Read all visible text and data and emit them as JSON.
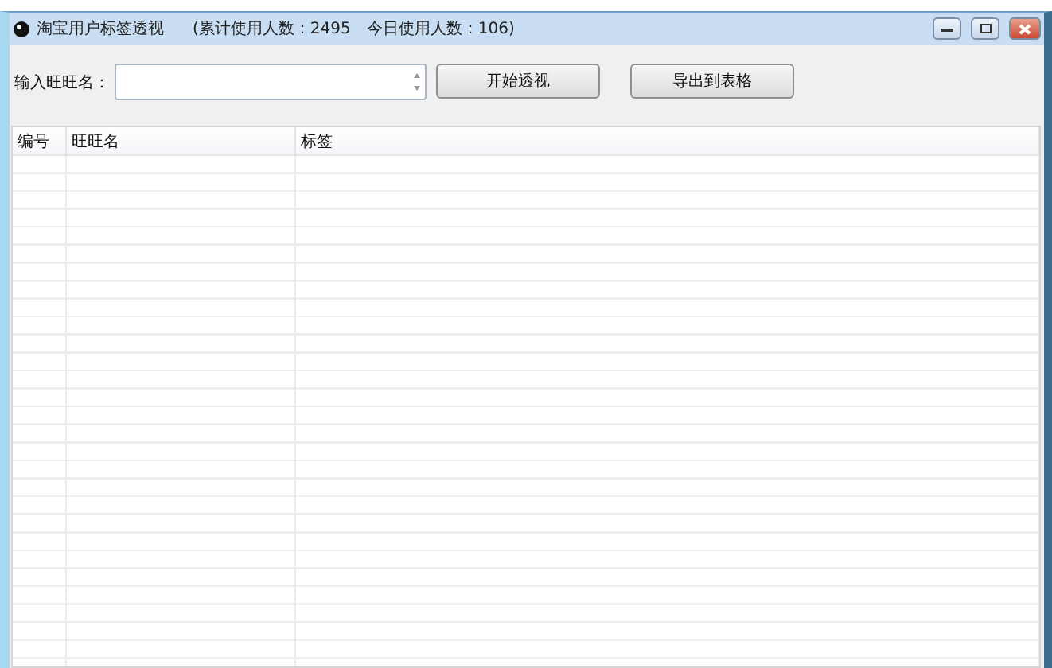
{
  "window": {
    "title": "淘宝用户标签透视",
    "stats": "(累计使用人数：2495　今日使用人数：106)"
  },
  "input": {
    "label": "输入旺旺名："
  },
  "buttons": [
    "开始透视",
    "导出到表格"
  ],
  "table": {
    "columns": [
      "编号",
      "旺旺名",
      "标签"
    ]
  }
}
